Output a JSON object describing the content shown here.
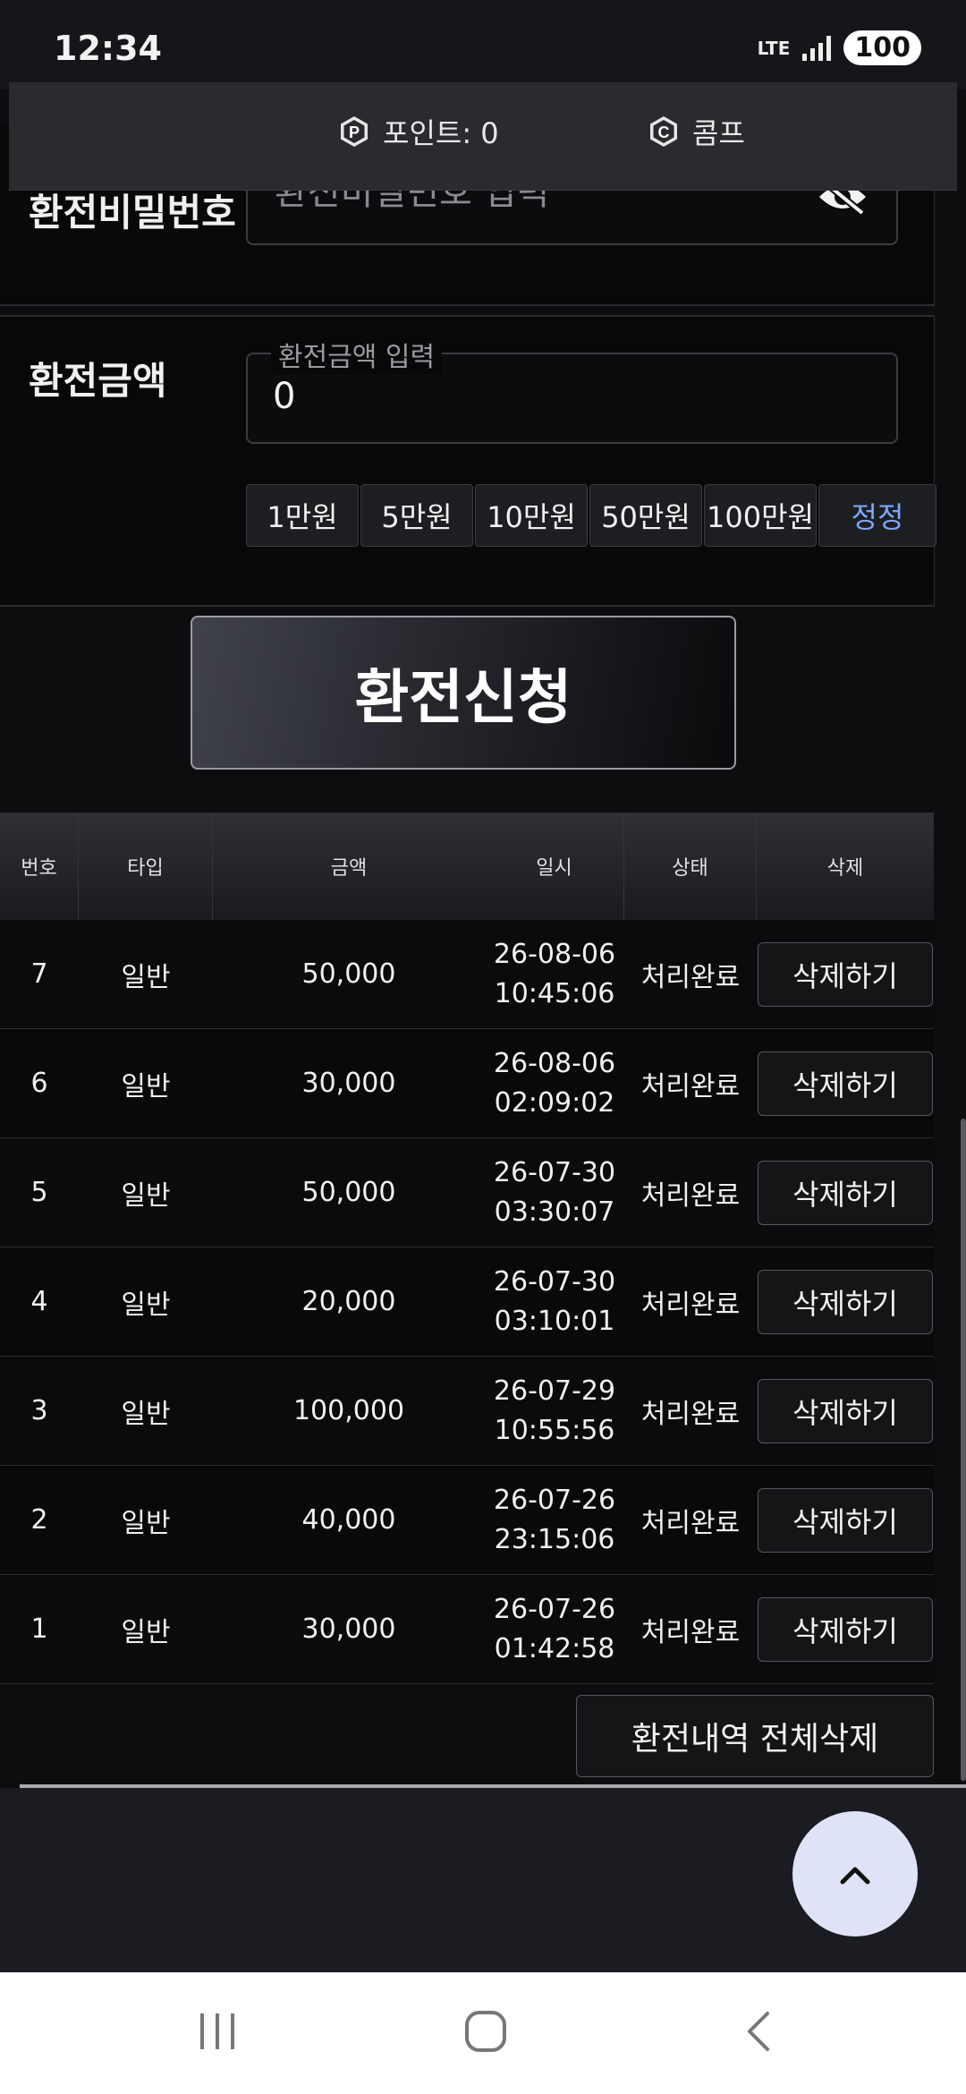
{
  "status_bar": {
    "time": "12:34",
    "network": "LTE",
    "battery": "100"
  },
  "points_bar": {
    "points_label": "포인트: 0",
    "comp_label": "콤프",
    "points_icon_letter": "P",
    "comp_icon_letter": "C"
  },
  "form": {
    "password_label": "환전비밀번호",
    "password_placeholder": "환전비밀번호 입력",
    "amount_label": "환전금액",
    "amount_legend": "환전금액 입력",
    "amount_value": "0",
    "amount_buttons": [
      "1만원",
      "5만원",
      "10만원",
      "50만원",
      "100만원"
    ],
    "reset_label": "정정",
    "submit_label": "환전신청"
  },
  "table": {
    "headers": [
      "번호",
      "타입",
      "금액",
      "일시",
      "상태",
      "삭제"
    ],
    "rows": [
      {
        "no": "7",
        "type": "일반",
        "amount": "50,000",
        "date": "26-08-06",
        "time": "10:45:06",
        "status": "처리완료",
        "action": "삭제하기"
      },
      {
        "no": "6",
        "type": "일반",
        "amount": "30,000",
        "date": "26-08-06",
        "time": "02:09:02",
        "status": "처리완료",
        "action": "삭제하기"
      },
      {
        "no": "5",
        "type": "일반",
        "amount": "50,000",
        "date": "26-07-30",
        "time": "03:30:07",
        "status": "처리완료",
        "action": "삭제하기"
      },
      {
        "no": "4",
        "type": "일반",
        "amount": "20,000",
        "date": "26-07-30",
        "time": "03:10:01",
        "status": "처리완료",
        "action": "삭제하기"
      },
      {
        "no": "3",
        "type": "일반",
        "amount": "100,000",
        "date": "26-07-29",
        "time": "10:55:56",
        "status": "처리완료",
        "action": "삭제하기"
      },
      {
        "no": "2",
        "type": "일반",
        "amount": "40,000",
        "date": "26-07-26",
        "time": "23:15:06",
        "status": "처리완료",
        "action": "삭제하기"
      },
      {
        "no": "1",
        "type": "일반",
        "amount": "30,000",
        "date": "26-07-26",
        "time": "01:42:58",
        "status": "처리완료",
        "action": "삭제하기"
      }
    ],
    "delete_all_label": "환전내역 전체삭제"
  },
  "colors": {
    "accent_link": "#7aa6ff",
    "fab_bg": "#dfe3f7",
    "background": "#0d0d0f"
  }
}
